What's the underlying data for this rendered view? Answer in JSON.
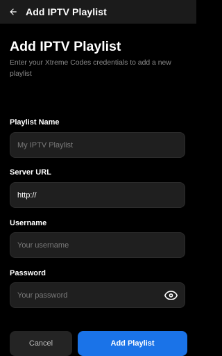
{
  "appbar": {
    "title": "Add IPTV Playlist",
    "back_icon": "arrow-left-icon"
  },
  "form": {
    "heading": "Add IPTV Playlist",
    "subtitle": "Enter your Xtreme Codes credentials to add a new playlist",
    "playlist_name": {
      "label": "Playlist Name",
      "value": "",
      "placeholder": "My IPTV Playlist"
    },
    "server_url": {
      "label": "Server URL",
      "value": "http://",
      "placeholder": ""
    },
    "username": {
      "label": "Username",
      "value": "",
      "placeholder": "Your username"
    },
    "password": {
      "label": "Password",
      "value": "",
      "placeholder": "Your password",
      "toggle_icon": "eye-icon"
    }
  },
  "actions": {
    "cancel_label": "Cancel",
    "submit_label": "Add Playlist"
  },
  "colors": {
    "background": "#000000",
    "appbar": "#1b1b1b",
    "field": "#1f1f1f",
    "primary": "#1a73e8",
    "secondary_button": "#242424",
    "muted_text": "#8a8a8a"
  }
}
